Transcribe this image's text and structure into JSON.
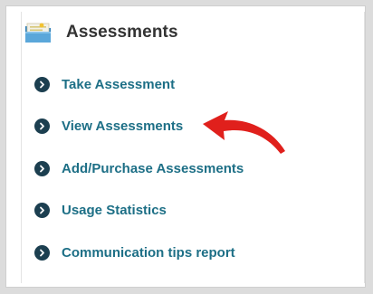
{
  "header": {
    "title": "Assessments",
    "icon": "folder-icon"
  },
  "menu": {
    "items": [
      {
        "label": "Take Assessment",
        "icon": "chevron-right-circle-icon"
      },
      {
        "label": "View Assessments",
        "icon": "chevron-right-circle-icon"
      },
      {
        "label": "Add/Purchase Assessments",
        "icon": "chevron-right-circle-icon"
      },
      {
        "label": "Usage Statistics",
        "icon": "chevron-right-circle-icon"
      },
      {
        "label": "Communication tips report",
        "icon": "chevron-right-circle-icon"
      }
    ]
  },
  "annotation": {
    "icon": "red-arrow-icon",
    "color": "#e0201c"
  },
  "colors": {
    "link": "#1d6f86",
    "bullet": "#1c3f50",
    "title": "#333333"
  }
}
